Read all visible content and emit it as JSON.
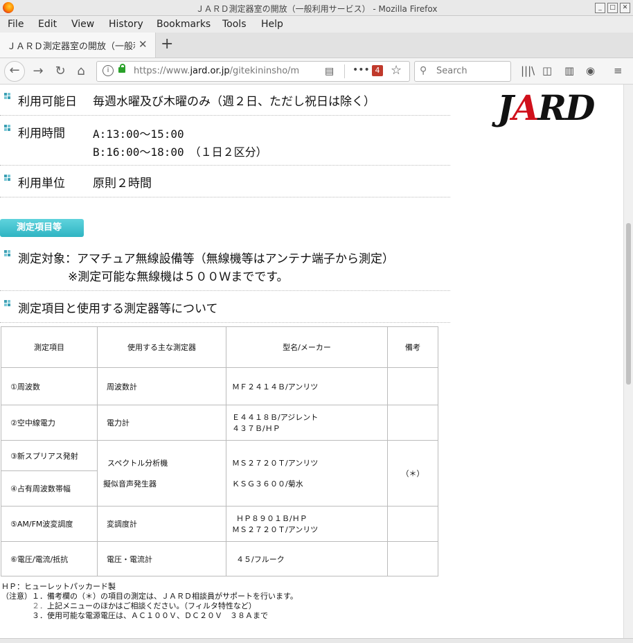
{
  "window": {
    "title": "ＪＡＲＤ測定器室の開放（一般利用サービス） - Mozilla Firefox"
  },
  "menu": [
    "File",
    "Edit",
    "View",
    "History",
    "Bookmarks",
    "Tools",
    "Help"
  ],
  "tab": {
    "title": "ＪＡＲＤ測定器室の開放（一般利"
  },
  "nav": {
    "url_prefix": "https://www.",
    "url_domain": "jard.or.jp",
    "url_path": "/gitekininsho/m",
    "badge": "4",
    "search_placeholder": "Search"
  },
  "page": {
    "logo": "JARD",
    "rows": [
      {
        "label": "利用可能日",
        "value": "毎週水曜及び木曜のみ（週２日、ただし祝日は除く）"
      },
      {
        "label": "利用時間",
        "value": "A:13:00～15:00",
        "value2": "B:16:00～18:00　（１日２区分）"
      },
      {
        "label": "利用単位",
        "value": "原則２時間"
      }
    ],
    "heading": "測定項目等",
    "target_line1": "測定対象：アマチュア無線設備等（無線機等はアンテナ端子から測定）",
    "target_line2": "※測定可能な無線機は５００Ｗまでです。",
    "items_title": "測定項目と使用する測定器等について",
    "table": {
      "headers": [
        "測定項目",
        "使用する主な測定器",
        "型名/メーカー",
        "備考"
      ],
      "r1": [
        "①周波数",
        "周波数計",
        "ＭＦ２４１４Ｂ/アンリツ",
        ""
      ],
      "r2": [
        "②空中線電力",
        "電力計",
        "Ｅ４４１８Ｂ/アジレント",
        "４３７Ｂ/ＨＰ",
        ""
      ],
      "r3a": "③新スプリアス発射",
      "r3b": "④占有周波数帯幅",
      "r3_instr1": "スペクトル分析機",
      "r3_instr2": "擬似音声発生器",
      "r3_model1": "ＭＳ２７２０Ｔ/アンリツ",
      "r3_model2": "ＫＳＧ３６００/菊水",
      "r3_note": "（＊）",
      "r5": [
        "⑤AM/FM波変調度",
        "変調度計",
        "ＨＰ８９０１Ｂ/ＨＰ",
        "ＭＳ２７２０Ｔ/アンリツ"
      ],
      "r6": [
        "⑥電圧/電流/抵抗",
        "電圧・電流計",
        "４５/フルーク"
      ]
    },
    "notes": {
      "hp": "ＨＰ：ヒューレットパッカード製",
      "n1": "（注意）１．備考欄の（＊）の項目の測定は、ＪＡＲＤ相談員がサポートを行います。",
      "n2a": "２．",
      "n2b": "上記メニューのほかはご相談ください。（フィルタ特性など）",
      "n3": "３．使用可能な電源電圧は、ＡＣ１００Ｖ、ＤＣ２０Ｖ　３８Ａまで"
    }
  }
}
